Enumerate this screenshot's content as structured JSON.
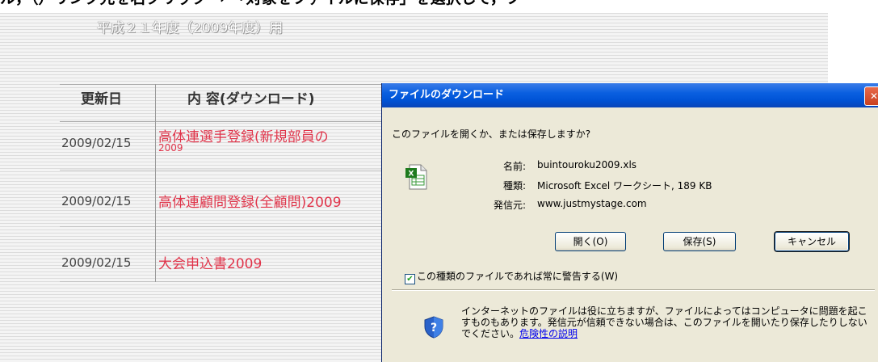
{
  "page": {
    "top_text": "ル，（）リンク先を右クリック → 「対象をファイルに保存」を選択して，フ",
    "subtitle": "平成２１年度（2009年度）用",
    "table": {
      "headers": [
        "更新日",
        "内 容(ダウンロード)"
      ],
      "rows": [
        {
          "date": "2009/02/15",
          "title": "高体連選手登録(新規部員の",
          "sub": "2009"
        },
        {
          "date": "2009/02/15",
          "title": "高体連顧問登録(全顧問)2009",
          "sub": ""
        },
        {
          "date": "2009/02/15",
          "title": "大会申込書2009",
          "sub": ""
        }
      ]
    }
  },
  "dialog": {
    "title": "ファイルのダウンロード",
    "question": "このファイルを開くか、または保存しますか?",
    "labels": {
      "name": "名前:",
      "type": "種類:",
      "from": "発信元:"
    },
    "values": {
      "name": "buintouroku2009.xls",
      "type": "Microsoft Excel ワークシート, 189 KB",
      "from": "www.justmystage.com"
    },
    "buttons": {
      "open": "開く(O)",
      "save": "保存(S)",
      "cancel": "キャンセル"
    },
    "checkbox_label": "この種類のファイルであれば常に警告する(W)",
    "checkbox_checked": true,
    "warning_text": "インターネットのファイルは役に立ちますが、ファイルによってはコンピュータに問題を起こすものもあります。発信元が信頼できない場合は、このファイルを開いたり保存したりしないでください。",
    "warning_link": "危険性の説明"
  },
  "icons": {
    "file": "excel-file-icon",
    "shield": "security-shield-icon",
    "close": "close-icon"
  }
}
